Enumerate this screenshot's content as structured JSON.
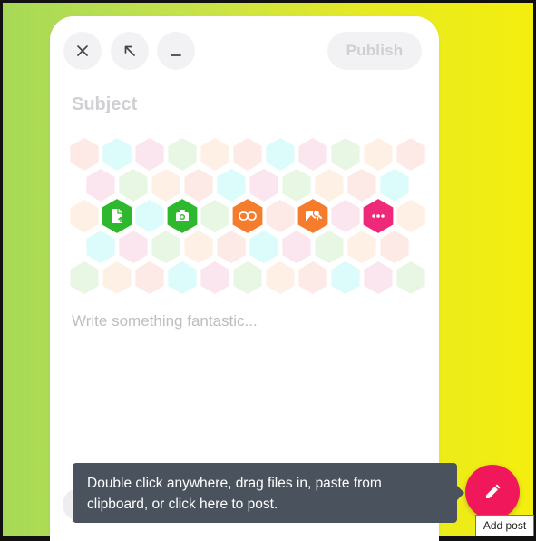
{
  "composer": {
    "subject_placeholder": "Subject",
    "body_placeholder": "Write something fantastic...",
    "publish_label": "Publish",
    "toolbar_icons": [
      "close-icon",
      "expand-icon",
      "minimize-icon"
    ],
    "attachments": [
      {
        "icon": "document-upload-icon",
        "color": "#2eb82e"
      },
      {
        "icon": "camera-icon",
        "color": "#2eb82e"
      },
      {
        "icon": "link-icon",
        "color": "#f57c2c"
      },
      {
        "icon": "image-search-icon",
        "color": "#f57c2c"
      },
      {
        "icon": "more-icon",
        "color": "#f0287a"
      }
    ]
  },
  "tooltip": {
    "line1": "Double click anywhere, drag files in, paste from",
    "line2": "clipboard, or click here to post."
  },
  "fab": {
    "label": "Add post",
    "icon": "pencil-icon",
    "color": "#f0185a"
  },
  "colors": {
    "hex_pattern": [
      "#fde9e6",
      "#dcfbfb",
      "#fbe6ef",
      "#e7f7e3",
      "#fff0e6"
    ]
  }
}
